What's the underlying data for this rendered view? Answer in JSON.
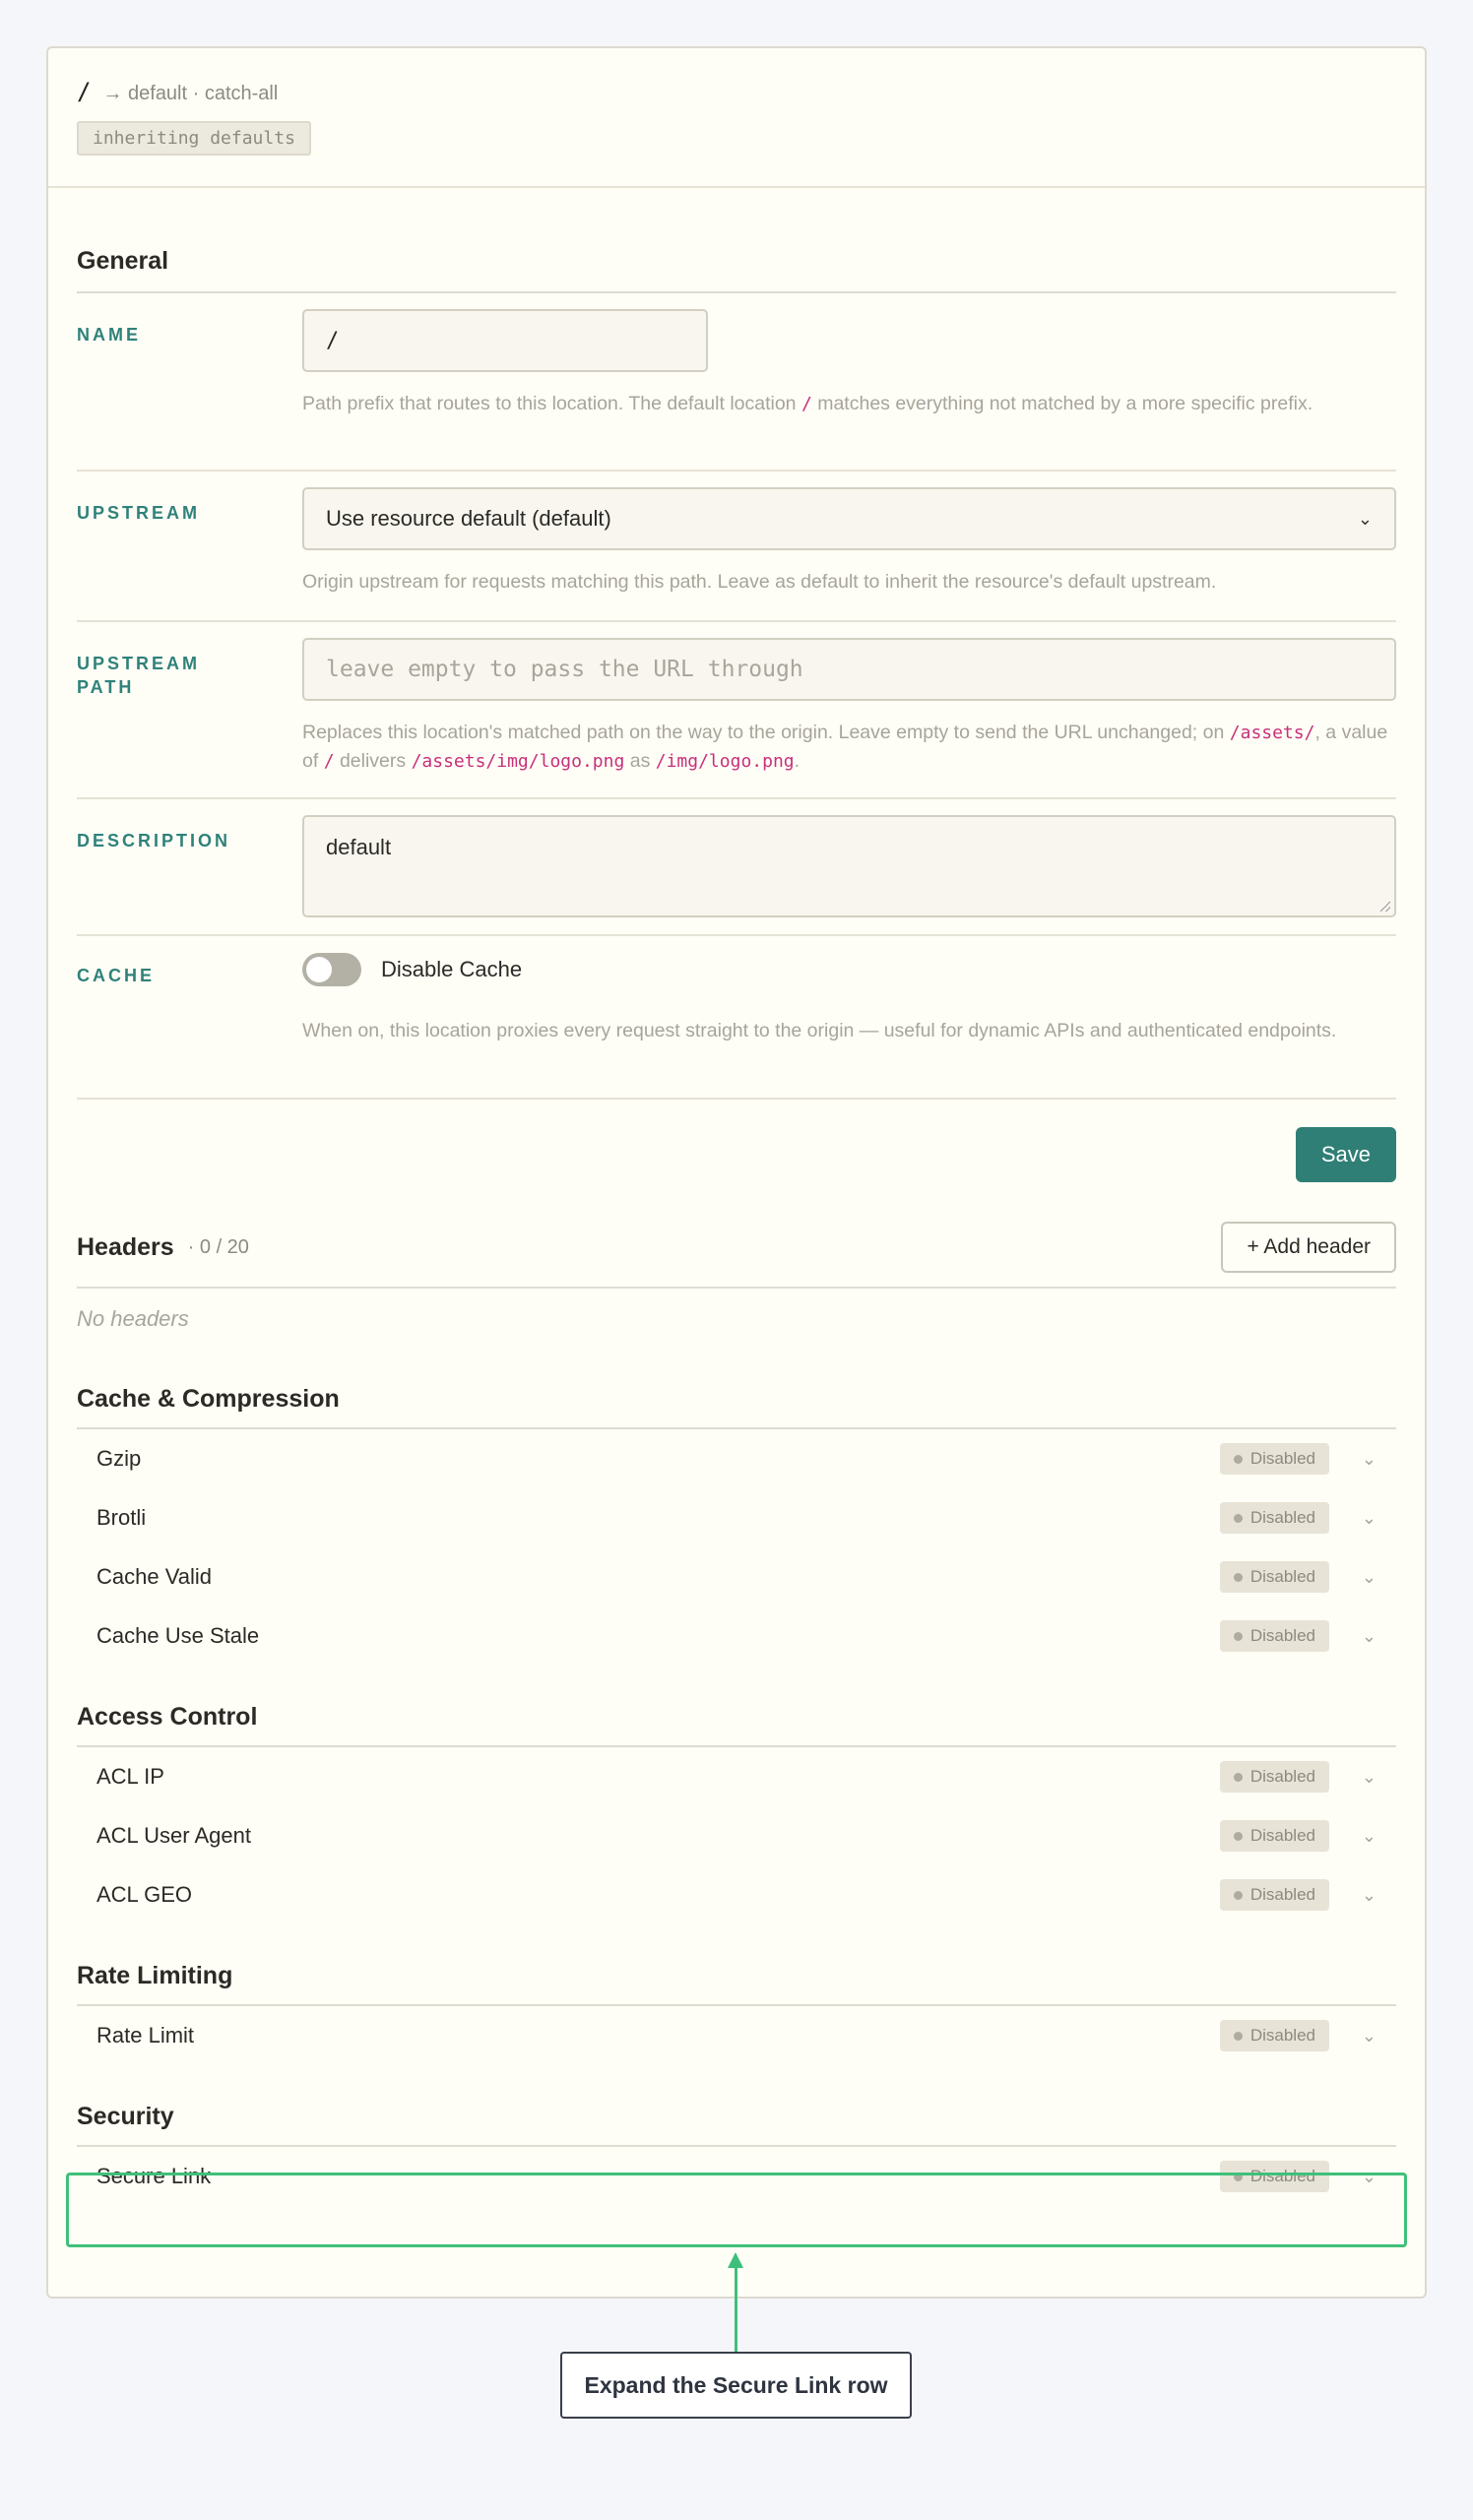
{
  "header": {
    "path": "/",
    "route_text": "→ default · catch-all",
    "inherit_badge": "inheriting defaults"
  },
  "general": {
    "title": "General",
    "name": {
      "label": "NAME",
      "value": "/",
      "help_pre": "Path prefix that routes to this location. The default location ",
      "help_code": "/",
      "help_post": " matches everything not matched by a more specific prefix."
    },
    "upstream": {
      "label": "UPSTREAM",
      "selected": "Use resource default (default)",
      "help": "Origin upstream for requests matching this path. Leave as default to inherit the resource's default upstream."
    },
    "upstream_path": {
      "label": "UPSTREAM PATH",
      "placeholder": "leave empty to pass the URL through",
      "help_1": "Replaces this location's matched path on the way to the origin. Leave empty to send the URL unchanged; on ",
      "code_1": "/assets/",
      "help_2": ", a value of ",
      "code_2": "/",
      "help_3": " delivers ",
      "code_3": "/assets/img/logo.png",
      "help_4": " as ",
      "code_4": "/img/logo.png",
      "help_5": "."
    },
    "description": {
      "label": "DESCRIPTION",
      "value": "default"
    },
    "cache": {
      "label": "CACHE",
      "toggle_label": "Disable Cache",
      "toggle_on": false,
      "help": "When on, this location proxies every request straight to the origin — useful for dynamic APIs and authenticated endpoints."
    },
    "save_label": "Save"
  },
  "headers": {
    "title": "Headers",
    "count": "· 0 / 20",
    "add_label": "+ Add header",
    "empty_text": "No headers"
  },
  "groups": [
    {
      "title": "Cache & Compression",
      "items": [
        {
          "name": "Gzip",
          "status": "Disabled"
        },
        {
          "name": "Brotli",
          "status": "Disabled"
        },
        {
          "name": "Cache Valid",
          "status": "Disabled"
        },
        {
          "name": "Cache Use Stale",
          "status": "Disabled"
        }
      ]
    },
    {
      "title": "Access Control",
      "items": [
        {
          "name": "ACL IP",
          "status": "Disabled"
        },
        {
          "name": "ACL User Agent",
          "status": "Disabled"
        },
        {
          "name": "ACL GEO",
          "status": "Disabled"
        }
      ]
    },
    {
      "title": "Rate Limiting",
      "items": [
        {
          "name": "Rate Limit",
          "status": "Disabled"
        }
      ]
    },
    {
      "title": "Security",
      "items": [
        {
          "name": "Secure Link",
          "status": "Disabled"
        }
      ]
    }
  ],
  "annotation": {
    "callout_text": "Expand the Secure Link row",
    "highlight_color": "#3fc07a"
  },
  "colors": {
    "accent": "#2f7f76",
    "label": "#2f827a",
    "code": "#c8307a"
  }
}
